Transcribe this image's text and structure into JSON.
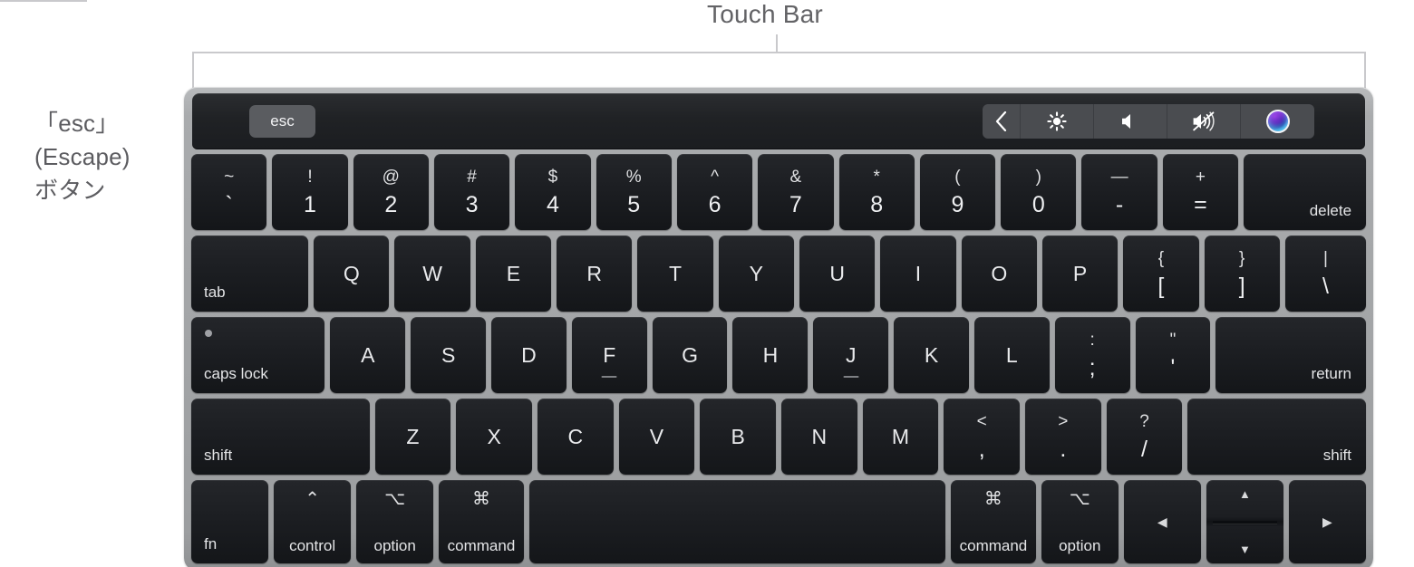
{
  "annotations": {
    "touch_bar_label": "Touch Bar",
    "esc_label_line1": "「esc」",
    "esc_label_line2": "(Escape)",
    "esc_label_line3": "ボタン"
  },
  "colors": {
    "chassis": "#a3a5a7",
    "key_face": "#1c1e22",
    "key_text": "#e9eaec",
    "touchbar_bg": "#202225",
    "esc_key_bg": "#5a5c60",
    "control_strip_bg": "#4a4c50",
    "leader_line": "#c9c9cc",
    "label_text": "#636366",
    "siri_top": "#8e3ddd",
    "siri_bottom": "#30c8f0"
  },
  "touch_bar": {
    "esc_key": "esc",
    "control_strip": [
      {
        "name": "expand-chevron-icon",
        "icon": "chevron-left",
        "label": ""
      },
      {
        "name": "brightness-icon",
        "icon": "sun",
        "label": ""
      },
      {
        "name": "volume-icon",
        "icon": "speaker",
        "label": ""
      },
      {
        "name": "mute-icon",
        "icon": "speaker-mute",
        "label": ""
      },
      {
        "name": "siri-icon",
        "icon": "siri-orb",
        "label": ""
      }
    ]
  },
  "keyboard": {
    "rows": [
      {
        "name": "number-row",
        "keys": [
          {
            "name": "key-backtick",
            "type": "dual",
            "top": "~",
            "bot": "`",
            "w": 1
          },
          {
            "name": "key-1",
            "type": "dual",
            "top": "!",
            "bot": "1",
            "w": 1
          },
          {
            "name": "key-2",
            "type": "dual",
            "top": "@",
            "bot": "2",
            "w": 1
          },
          {
            "name": "key-3",
            "type": "dual",
            "top": "#",
            "bot": "3",
            "w": 1
          },
          {
            "name": "key-4",
            "type": "dual",
            "top": "$",
            "bot": "4",
            "w": 1
          },
          {
            "name": "key-5",
            "type": "dual",
            "top": "%",
            "bot": "5",
            "w": 1
          },
          {
            "name": "key-6",
            "type": "dual",
            "top": "^",
            "bot": "6",
            "w": 1
          },
          {
            "name": "key-7",
            "type": "dual",
            "top": "&",
            "bot": "7",
            "w": 1
          },
          {
            "name": "key-8",
            "type": "dual",
            "top": "*",
            "bot": "8",
            "w": 1
          },
          {
            "name": "key-9",
            "type": "dual",
            "top": "(",
            "bot": "9",
            "w": 1
          },
          {
            "name": "key-0",
            "type": "dual",
            "top": ")",
            "bot": "0",
            "w": 1
          },
          {
            "name": "key-minus",
            "type": "dual",
            "top": "—",
            "bot": "-",
            "w": 1
          },
          {
            "name": "key-equals",
            "type": "dual",
            "top": "+",
            "bot": "=",
            "w": 1
          },
          {
            "name": "key-delete",
            "type": "label-right",
            "label": "delete",
            "w": 1.62
          }
        ]
      },
      {
        "name": "qwerty-row",
        "keys": [
          {
            "name": "key-tab",
            "type": "label-left",
            "label": "tab",
            "w": 1.55
          },
          {
            "name": "key-q",
            "type": "letter",
            "label": "Q",
            "w": 1
          },
          {
            "name": "key-w",
            "type": "letter",
            "label": "W",
            "w": 1
          },
          {
            "name": "key-e",
            "type": "letter",
            "label": "E",
            "w": 1
          },
          {
            "name": "key-r",
            "type": "letter",
            "label": "R",
            "w": 1
          },
          {
            "name": "key-t",
            "type": "letter",
            "label": "T",
            "w": 1
          },
          {
            "name": "key-y",
            "type": "letter",
            "label": "Y",
            "w": 1
          },
          {
            "name": "key-u",
            "type": "letter",
            "label": "U",
            "w": 1
          },
          {
            "name": "key-i",
            "type": "letter",
            "label": "I",
            "w": 1
          },
          {
            "name": "key-o",
            "type": "letter",
            "label": "O",
            "w": 1
          },
          {
            "name": "key-p",
            "type": "letter",
            "label": "P",
            "w": 1
          },
          {
            "name": "key-bracket-left",
            "type": "dual",
            "top": "{",
            "bot": "[",
            "w": 1
          },
          {
            "name": "key-bracket-right",
            "type": "dual",
            "top": "}",
            "bot": "]",
            "w": 1
          },
          {
            "name": "key-backslash",
            "type": "dual",
            "top": "|",
            "bot": "\\",
            "w": 1.07
          }
        ]
      },
      {
        "name": "home-row",
        "keys": [
          {
            "name": "key-caps-lock",
            "type": "caps",
            "label": "caps lock",
            "w": 1.78
          },
          {
            "name": "key-a",
            "type": "letter",
            "label": "A",
            "w": 1
          },
          {
            "name": "key-s",
            "type": "letter",
            "label": "S",
            "w": 1
          },
          {
            "name": "key-d",
            "type": "letter",
            "label": "D",
            "w": 1
          },
          {
            "name": "key-f",
            "type": "letter-homing",
            "label": "F",
            "w": 1
          },
          {
            "name": "key-g",
            "type": "letter",
            "label": "G",
            "w": 1
          },
          {
            "name": "key-h",
            "type": "letter",
            "label": "H",
            "w": 1
          },
          {
            "name": "key-j",
            "type": "letter-homing",
            "label": "J",
            "w": 1
          },
          {
            "name": "key-k",
            "type": "letter",
            "label": "K",
            "w": 1
          },
          {
            "name": "key-l",
            "type": "letter",
            "label": "L",
            "w": 1
          },
          {
            "name": "key-semicolon",
            "type": "dual",
            "top": ":",
            "bot": ";",
            "w": 1
          },
          {
            "name": "key-quote",
            "type": "dual",
            "top": "\"",
            "bot": "'",
            "w": 1
          },
          {
            "name": "key-return",
            "type": "label-right",
            "label": "return",
            "w": 2.0
          }
        ]
      },
      {
        "name": "shift-row",
        "keys": [
          {
            "name": "key-shift-left",
            "type": "label-left",
            "label": "shift",
            "w": 2.35
          },
          {
            "name": "key-z",
            "type": "letter",
            "label": "Z",
            "w": 1
          },
          {
            "name": "key-x",
            "type": "letter",
            "label": "X",
            "w": 1
          },
          {
            "name": "key-c",
            "type": "letter",
            "label": "C",
            "w": 1
          },
          {
            "name": "key-v",
            "type": "letter",
            "label": "V",
            "w": 1
          },
          {
            "name": "key-b",
            "type": "letter",
            "label": "B",
            "w": 1
          },
          {
            "name": "key-n",
            "type": "letter",
            "label": "N",
            "w": 1
          },
          {
            "name": "key-m",
            "type": "letter",
            "label": "M",
            "w": 1
          },
          {
            "name": "key-comma",
            "type": "dual",
            "top": "<",
            "bot": ",",
            "w": 1
          },
          {
            "name": "key-period",
            "type": "dual",
            "top": ">",
            "bot": ".",
            "w": 1
          },
          {
            "name": "key-slash",
            "type": "dual",
            "top": "?",
            "bot": "/",
            "w": 1
          },
          {
            "name": "key-shift-right",
            "type": "label-right",
            "label": "shift",
            "w": 2.35
          }
        ]
      },
      {
        "name": "bottom-row",
        "keys": [
          {
            "name": "key-fn",
            "type": "label-left",
            "label": "fn",
            "w": 1.0
          },
          {
            "name": "key-control",
            "type": "mod",
            "glyph": "⌃",
            "label": "control",
            "w": 1.0
          },
          {
            "name": "key-option-left",
            "type": "mod",
            "glyph": "⌥",
            "label": "option",
            "w": 1.0
          },
          {
            "name": "key-command-left",
            "type": "mod",
            "glyph": "⌘",
            "label": "command",
            "w": 1.1
          },
          {
            "name": "key-space",
            "type": "blank",
            "label": "",
            "w": 5.4
          },
          {
            "name": "key-command-right",
            "type": "mod",
            "glyph": "⌘",
            "label": "command",
            "w": 1.1
          },
          {
            "name": "key-option-right",
            "type": "mod",
            "glyph": "⌥",
            "label": "option",
            "w": 1.0
          },
          {
            "name": "key-arrow-left",
            "type": "arrow",
            "label": "◀",
            "w": 1.0
          },
          {
            "name": "key-arrow-updown",
            "type": "updown",
            "up": "▲",
            "down": "▼",
            "w": 1.0
          },
          {
            "name": "key-arrow-right",
            "type": "arrow",
            "label": "▶",
            "w": 1.0
          }
        ]
      }
    ]
  }
}
